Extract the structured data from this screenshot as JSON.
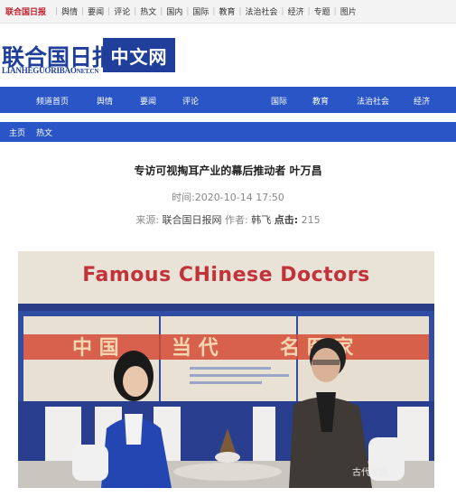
{
  "topbar": {
    "home": "联合国日报",
    "links": [
      "舆情",
      "要闻",
      "评论",
      "热文",
      "国内",
      "国际",
      "教育",
      "法治社会",
      "经济",
      "专题",
      "图片"
    ]
  },
  "header": {
    "logo_cn": "联合国日报",
    "logo_en": "LIANHEGUORIBAO",
    "logo_en_suffix": "NET.CN",
    "logo_box": "中文网"
  },
  "nav": {
    "items": [
      "频道首页",
      "舆情",
      "要闻",
      "评论",
      "国际",
      "教育",
      "法治社会",
      "经济"
    ]
  },
  "breadcrumb": {
    "home": "主页",
    "section": "热文"
  },
  "article": {
    "title": "专访可视掏耳产业的幕后推动者 叶万昌",
    "time_label": "时间:",
    "time_value": "2020-10-14 17:50",
    "source_label": "来源:",
    "source_value": "联合国日报网",
    "author_label": "作者:",
    "author_value": "韩飞",
    "clicks_label": "点击:",
    "clicks_value": "215"
  },
  "photo": {
    "banner": "Famous CHinese Doctors",
    "watermark": "古代名医"
  },
  "colors": {
    "brand_blue": "#1f3f9a",
    "nav_blue": "#2a55c6",
    "topbar_red": "#c0202a",
    "banner_red": "#c1323a"
  }
}
